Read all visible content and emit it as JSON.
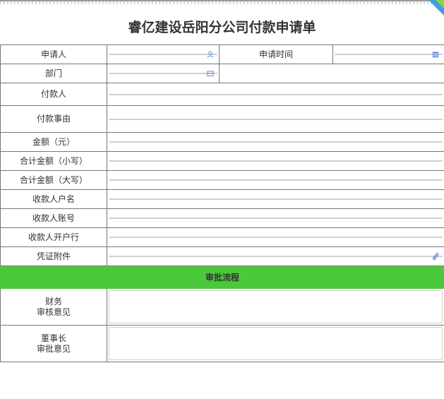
{
  "form": {
    "title": "睿亿建设岳阳分公司付款申请单",
    "labels": {
      "applicant": "申请人",
      "apply_time": "申请时间",
      "department": "部门",
      "payer": "付款人",
      "reason": "付款事由",
      "amount": "金额（元）",
      "total_lower": "合计金额（小写）",
      "total_upper": "合计金额（大写）",
      "payee_name": "收款人户名",
      "payee_account": "收款人账号",
      "payee_bank": "收款人开户行",
      "attachment": "凭证附件",
      "finance_line1": "财务",
      "finance_line2": "审核意见",
      "chairman_line1": "董事长",
      "chairman_line2": "审批意见"
    },
    "section_title": "审批流程",
    "values": {
      "applicant": "",
      "apply_time": "",
      "department": "",
      "payer": "",
      "reason": "",
      "amount": "",
      "total_lower": "",
      "total_upper": "",
      "payee_name": "",
      "payee_account": "",
      "payee_bank": "",
      "finance_opinion": "",
      "chairman_opinion": ""
    }
  },
  "icons": {
    "applicant": "user-icon",
    "apply_time": "calendar-icon",
    "department": "org-icon",
    "attachment": "paperclip-icon"
  },
  "colors": {
    "section_bg": "#4cc93a",
    "icon": "#5b8fd6",
    "corner_blue": "#3aa0e0",
    "corner_green": "#8fd14f"
  }
}
